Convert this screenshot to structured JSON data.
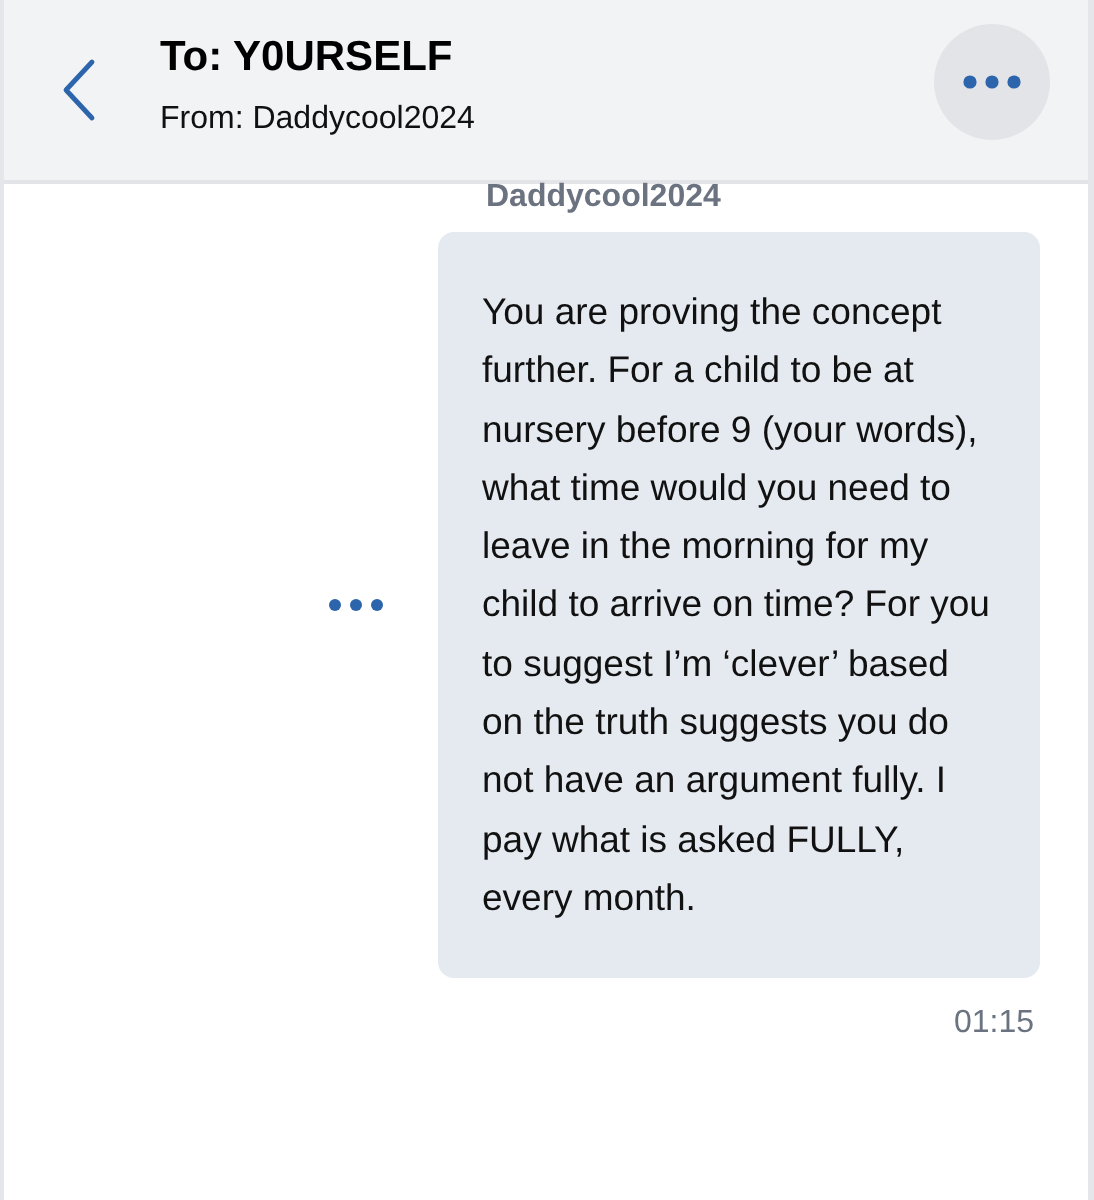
{
  "header": {
    "title": "To: Y0URSELF",
    "subtitle": "From: Daddycool2024"
  },
  "messages": [
    {
      "sender": "Daddycool2024",
      "text": "You are proving the concept further. For a child to be at nursery before 9 (your words), what time would you need to leave in the morning for my child to arrive on time? For you to suggest I’m ‘clever’ based on the truth suggests you do not have an argument fully. I pay what is asked FULLY, every month.",
      "time": "01:15"
    }
  ]
}
